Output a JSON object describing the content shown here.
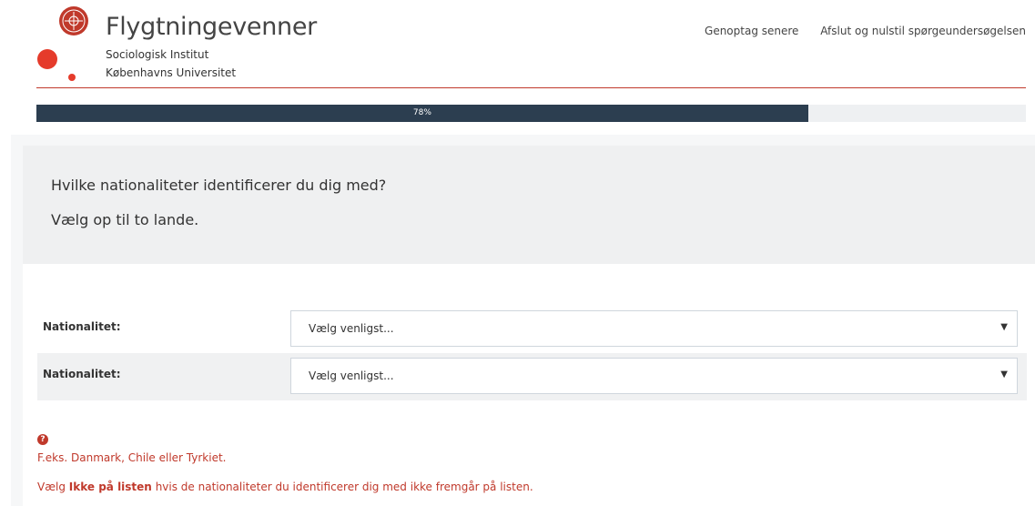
{
  "header": {
    "title": "Flygtningevenner",
    "subtitle_1": "Sociologisk Institut",
    "subtitle_2": "Københavns Universitet",
    "links": {
      "resume": "Genoptag senere",
      "reset": "Afslut og nulstil spørgeundersøgelsen"
    }
  },
  "progress": {
    "label": "78%",
    "value": 78
  },
  "question": {
    "text": "Hvilke nationaliteter identificerer du dig med?",
    "sub": "Vælg op til to lande."
  },
  "rows": [
    {
      "label": "Nationalitet:",
      "selected": "Vælg venligst..."
    },
    {
      "label": "Nationalitet:",
      "selected": "Vælg venligst..."
    }
  ],
  "help": {
    "icon": "?",
    "line1": "F.eks. Danmark, Chile eller Tyrkiet.",
    "line2_prefix": "Vælg",
    "line2_bold": "Ikke på listen",
    "line2_suffix": "hvis de nationaliteter du identificerer dig med ikke fremgår på listen."
  },
  "colors": {
    "accent": "#c0392b",
    "progress": "#2c3e50",
    "panel": "#eff0f1"
  }
}
